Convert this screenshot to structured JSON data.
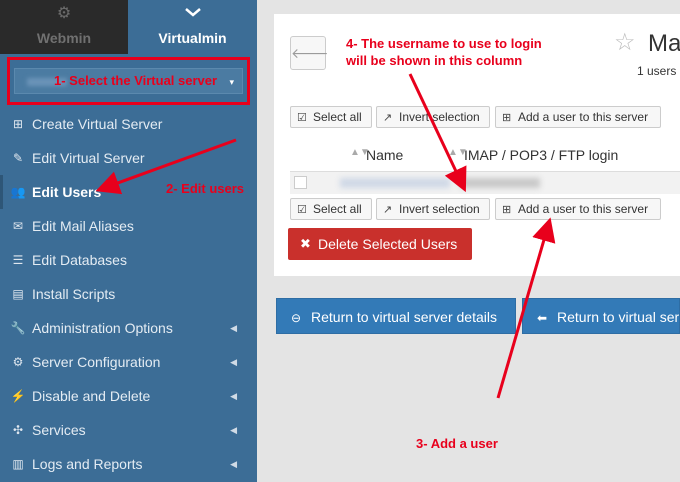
{
  "top_tabs": {
    "webmin": {
      "label": "Webmin",
      "icon": "gears-icon"
    },
    "virtualmin": {
      "label": "Virtualmin",
      "icon": "chevron-down-icon"
    }
  },
  "server_select": {
    "value": "",
    "caret": "▾"
  },
  "menu": [
    {
      "label": "Create Virtual Server",
      "icon": "plus-square-icon",
      "submenu": false,
      "active": false
    },
    {
      "label": "Edit Virtual Server",
      "icon": "edit-icon",
      "submenu": false,
      "active": false
    },
    {
      "label": "Edit Users",
      "icon": "users-icon",
      "submenu": false,
      "active": true
    },
    {
      "label": "Edit Mail Aliases",
      "icon": "envelope-icon",
      "submenu": false,
      "active": false
    },
    {
      "label": "Edit Databases",
      "icon": "database-icon",
      "submenu": false,
      "active": false
    },
    {
      "label": "Install Scripts",
      "icon": "archive-icon",
      "submenu": false,
      "active": false
    },
    {
      "label": "Administration Options",
      "icon": "wrench-icon",
      "submenu": true,
      "active": false
    },
    {
      "label": "Server Configuration",
      "icon": "cogs-icon",
      "submenu": true,
      "active": false
    },
    {
      "label": "Disable and Delete",
      "icon": "plug-icon",
      "submenu": true,
      "active": false
    },
    {
      "label": "Services",
      "icon": "puzzle-icon",
      "submenu": true,
      "active": false
    },
    {
      "label": "Logs and Reports",
      "icon": "file-icon",
      "submenu": true,
      "active": false
    }
  ],
  "header": {
    "title": "Ma",
    "subtitle": "1 users"
  },
  "toolbar": {
    "select_all": "Select all",
    "invert_selection": "Invert selection",
    "add_user": "Add a user to this server"
  },
  "table": {
    "col_name": "Name",
    "col_login": "IMAP / POP3 / FTP login"
  },
  "delete_button": "Delete Selected Users",
  "footer_buttons": {
    "return_details": "Return to virtual server details",
    "return_list": "Return to virtual ser"
  },
  "annotations": {
    "a1": "1- Select the Virtual server",
    "a2": "2- Edit users",
    "a3": "3- Add a user",
    "a4_line1": "4- The username to use to login",
    "a4_line2": "will be shown in this column"
  },
  "colors": {
    "annotation": "#e8001c",
    "sidebar": "#3c6d96",
    "primary": "#337ab7",
    "danger": "#c9302c"
  }
}
